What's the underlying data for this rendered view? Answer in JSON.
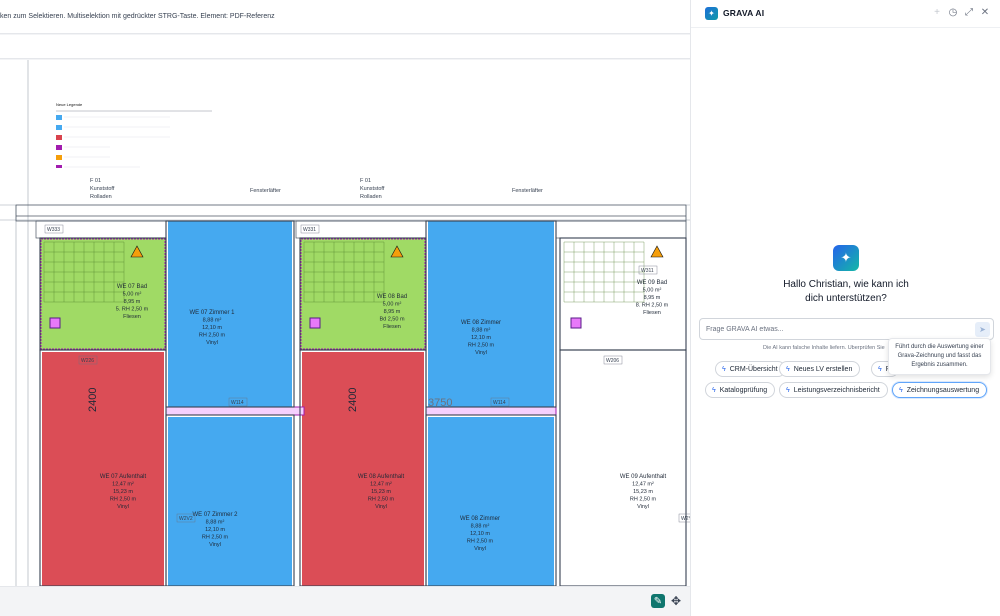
{
  "viewer": {
    "hint_text": "ken zum Selektieren. Multiselektion mit gedrückter STRG-Taste. Element: PDF-Referenz",
    "icons": {
      "primary_tool": "ai-edit-icon",
      "move": "move-arrows-icon"
    },
    "plan": {
      "colors": {
        "bath": "#8fd44a",
        "room": "#45a9f0",
        "living": "#d9434d",
        "purple": "#a21caf",
        "warning": "#f59e0b"
      },
      "rooms": {
        "we07_bad": [
          "WE 07 Bad",
          "5,00 m²",
          "8,95 m",
          "5. RH 2,50 m",
          "Fliesen"
        ],
        "we08_bad": [
          "WE 08 Bad",
          "5,00 m²",
          "8,95 m",
          "Bd 2,50 m",
          "Fliesen"
        ],
        "we09_bad": [
          "WE 09 Bad",
          "5,00 m²",
          "8,95 m",
          "8. RH 2,50 m",
          "Fliesen"
        ],
        "we07_zimmer1": [
          "WE 07 Zimmer 1",
          "8,88 m²",
          "12,10 m",
          "RH 2,50 m",
          "Vinyl"
        ],
        "we08_zimmer": [
          "WE 08 Zimmer",
          "8,88 m²",
          "12,10 m",
          "RH 2,50 m",
          "Vinyl"
        ],
        "we07_zimmer2": [
          "WE 07 Zimmer 2",
          "8,88 m²",
          "12,10 m",
          "RH 2,50 m",
          "Vinyl"
        ],
        "we08_zimmer2": [
          "WE 08 Zimmer",
          "8,88 m²",
          "12,10 m",
          "RH 2,50 m",
          "Vinyl"
        ],
        "we07_aufenthalt": [
          "WE 07 Aufenthalt",
          "12,47 m²",
          "15,23 m",
          "RH 2,50 m",
          "Vinyl"
        ],
        "we08_aufenthalt": [
          "WE 08 Aufenthalt",
          "12,47 m²",
          "15,23 m",
          "RH 2,50 m",
          "Vinyl"
        ],
        "we09_aufenthalt": [
          "WE 09 Aufenthalt",
          "12,47 m²",
          "15,23 m",
          "RH 2,50 m",
          "Vinyl"
        ]
      },
      "window_labels": [
        "F 01",
        "Kunststoff",
        "Rolladen",
        "Fensterläfter",
        "F 01",
        "Kunststoff",
        "Rolladen",
        "Fensterläfter"
      ],
      "dims": [
        "2400",
        "2400",
        "3750"
      ],
      "door_labels": [
        "W333",
        "W331",
        "W311",
        "W226",
        "W206",
        "W114",
        "W114",
        "W2V2",
        "W2Y2"
      ],
      "legend_title": "Neue Legende"
    }
  },
  "panel": {
    "title": "GRAVA AI",
    "icons": {
      "logo": "sparkle-logo-icon",
      "add": "plus-icon",
      "history": "history-icon",
      "expand": "expand-icon",
      "close": "close-icon",
      "hero": "sparkle-icon",
      "send": "send-icon",
      "chip": "bolt-icon"
    },
    "greeting_line1": "Hallo Christian, wie kann ich",
    "greeting_line2": "dich unterstützen?",
    "input_placeholder": "Frage GRAVA AI etwas...",
    "disclaimer": "Die AI kann falsche Inhalte liefern. Überprüfen Sie",
    "chips": {
      "crm": "CRM-Übersicht",
      "lv": "Neues LV erstellen",
      "p": "P",
      "katalog": "Katalogprüfung",
      "leistung": "Leistungsverzeichnisbericht",
      "zeichnung": "Zeichnungsauswertung"
    },
    "tooltip": "Führt durch die Auswertung einer Grava-Zeichnung und fasst das Ergebnis zusammen."
  }
}
